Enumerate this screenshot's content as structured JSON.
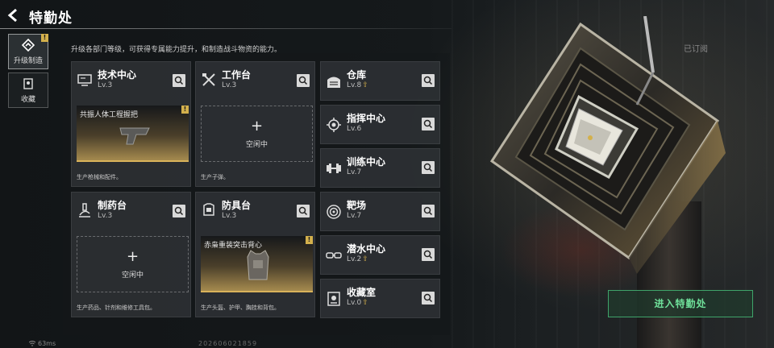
{
  "header": {
    "title": "特勤处"
  },
  "subscribed_label": "已订阅",
  "description": "升级各部门等级，可获得专属能力提升，和制造战斗物资的能力。",
  "tabs": [
    {
      "label": "升级制造",
      "icon": "upgrade-icon",
      "badge": "!"
    },
    {
      "label": "收藏",
      "icon": "collection-icon"
    }
  ],
  "workstations": [
    {
      "name": "技术中心",
      "level": "Lv.3",
      "icon": "monitor-icon",
      "slot": "producing",
      "product": "共振人体工程握把",
      "product_badge": "!",
      "footer": "生产枪械和配件。"
    },
    {
      "name": "工作台",
      "level": "Lv.3",
      "icon": "tools-icon",
      "slot": "idle",
      "idle_label": "空闲中",
      "footer": "生产子弹。"
    },
    {
      "name": "制药台",
      "level": "Lv.3",
      "icon": "microscope-icon",
      "slot": "idle",
      "idle_label": "空闲中",
      "footer": "生产药品、针剂和维修工具包。"
    },
    {
      "name": "防具台",
      "level": "Lv.3",
      "icon": "armor-icon",
      "slot": "producing",
      "product": "赤枭重装突击背心",
      "product_badge": "!",
      "footer": "生产头盔、护甲、胸挂和背包。"
    }
  ],
  "facilities": [
    {
      "name": "仓库",
      "level": "Lv.8",
      "upgrade": true,
      "icon": "warehouse-icon"
    },
    {
      "name": "指挥中心",
      "level": "Lv.6",
      "upgrade": false,
      "icon": "command-icon"
    },
    {
      "name": "训练中心",
      "level": "Lv.7",
      "upgrade": false,
      "icon": "dumbbell-icon"
    },
    {
      "name": "靶场",
      "level": "Lv.7",
      "upgrade": false,
      "icon": "target-icon"
    },
    {
      "name": "潜水中心",
      "level": "Lv.2",
      "upgrade": true,
      "icon": "diving-goggles-icon"
    },
    {
      "name": "收藏室",
      "level": "Lv.0",
      "upgrade": true,
      "icon": "collection-room-icon"
    }
  ],
  "upgrade_glyph": "⇧",
  "enter_button": "进入特勤处",
  "status": {
    "ping": "63ms",
    "build_id": "202606021859"
  },
  "colors": {
    "accent_gold": "#d3b04c",
    "enter_green": "#6fe09a"
  }
}
